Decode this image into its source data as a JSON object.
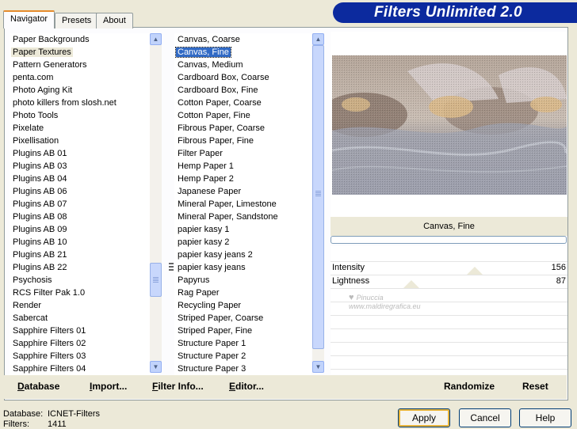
{
  "tabs": [
    {
      "label": "Navigator",
      "active": true
    },
    {
      "label": "Presets",
      "active": false
    },
    {
      "label": "About",
      "active": false
    }
  ],
  "app_title": "Filters Unlimited 2.0",
  "categories": {
    "items": [
      "Paper Backgrounds",
      "Paper Textures",
      "Pattern Generators",
      "penta.com",
      "Photo Aging Kit",
      "photo killers from slosh.net",
      "Photo Tools",
      "Pixelate",
      "Pixellisation",
      "Plugins AB 01",
      "Plugins AB 03",
      "Plugins AB 04",
      "Plugins AB 06",
      "Plugins AB 07",
      "Plugins AB 08",
      "Plugins AB 09",
      "Plugins AB 10",
      "Plugins AB 21",
      "Plugins AB 22",
      "Psychosis",
      "RCS Filter Pak 1.0",
      "Render",
      "Sabercat",
      "Sapphire Filters 01",
      "Sapphire Filters 02",
      "Sapphire Filters 03",
      "Sapphire Filters 04"
    ],
    "selected_index": 1
  },
  "filters": {
    "items": [
      "Canvas, Coarse",
      "Canvas, Fine",
      "Canvas, Medium",
      "Cardboard Box, Coarse",
      "Cardboard Box, Fine",
      "Cotton Paper, Coarse",
      "Cotton Paper, Fine",
      "Fibrous Paper, Coarse",
      "Fibrous Paper, Fine",
      "Filter Paper",
      "Hemp Paper 1",
      "Hemp Paper 2",
      "Japanese Paper",
      "Mineral Paper, Limestone",
      "Mineral Paper, Sandstone",
      "papier kasy 1",
      "papier kasy 2",
      "papier kasy jeans 2",
      "papier kasy jeans",
      "Papyrus",
      "Rag Paper",
      "Recycling Paper",
      "Striped Paper, Coarse",
      "Striped Paper, Fine",
      "Structure Paper 1",
      "Structure Paper 2",
      "Structure Paper 3"
    ],
    "selected_index": 1
  },
  "preview": {
    "filter_name": "Canvas, Fine",
    "watermark": "Pinuccia\nwww.maldiregrafica.eu"
  },
  "params": [
    {
      "label": "Intensity",
      "value": "156",
      "fraction": 0.61
    },
    {
      "label": "Lightness",
      "value": "87",
      "fraction": 0.34
    }
  ],
  "bottom_buttons": {
    "database": "Database",
    "import": "Import...",
    "filter_info": "Filter Info...",
    "editor": "Editor...",
    "randomize": "Randomize",
    "reset": "Reset"
  },
  "status": {
    "database_label": "Database:",
    "database_value": "ICNET-Filters",
    "filters_label": "Filters:",
    "filters_value": "1411"
  },
  "dialog_buttons": {
    "apply": "Apply",
    "cancel": "Cancel",
    "help": "Help"
  },
  "colors": {
    "banner": "#0c2a9e",
    "selection": "#316ac5",
    "tab_accent": "#e68b2c"
  }
}
